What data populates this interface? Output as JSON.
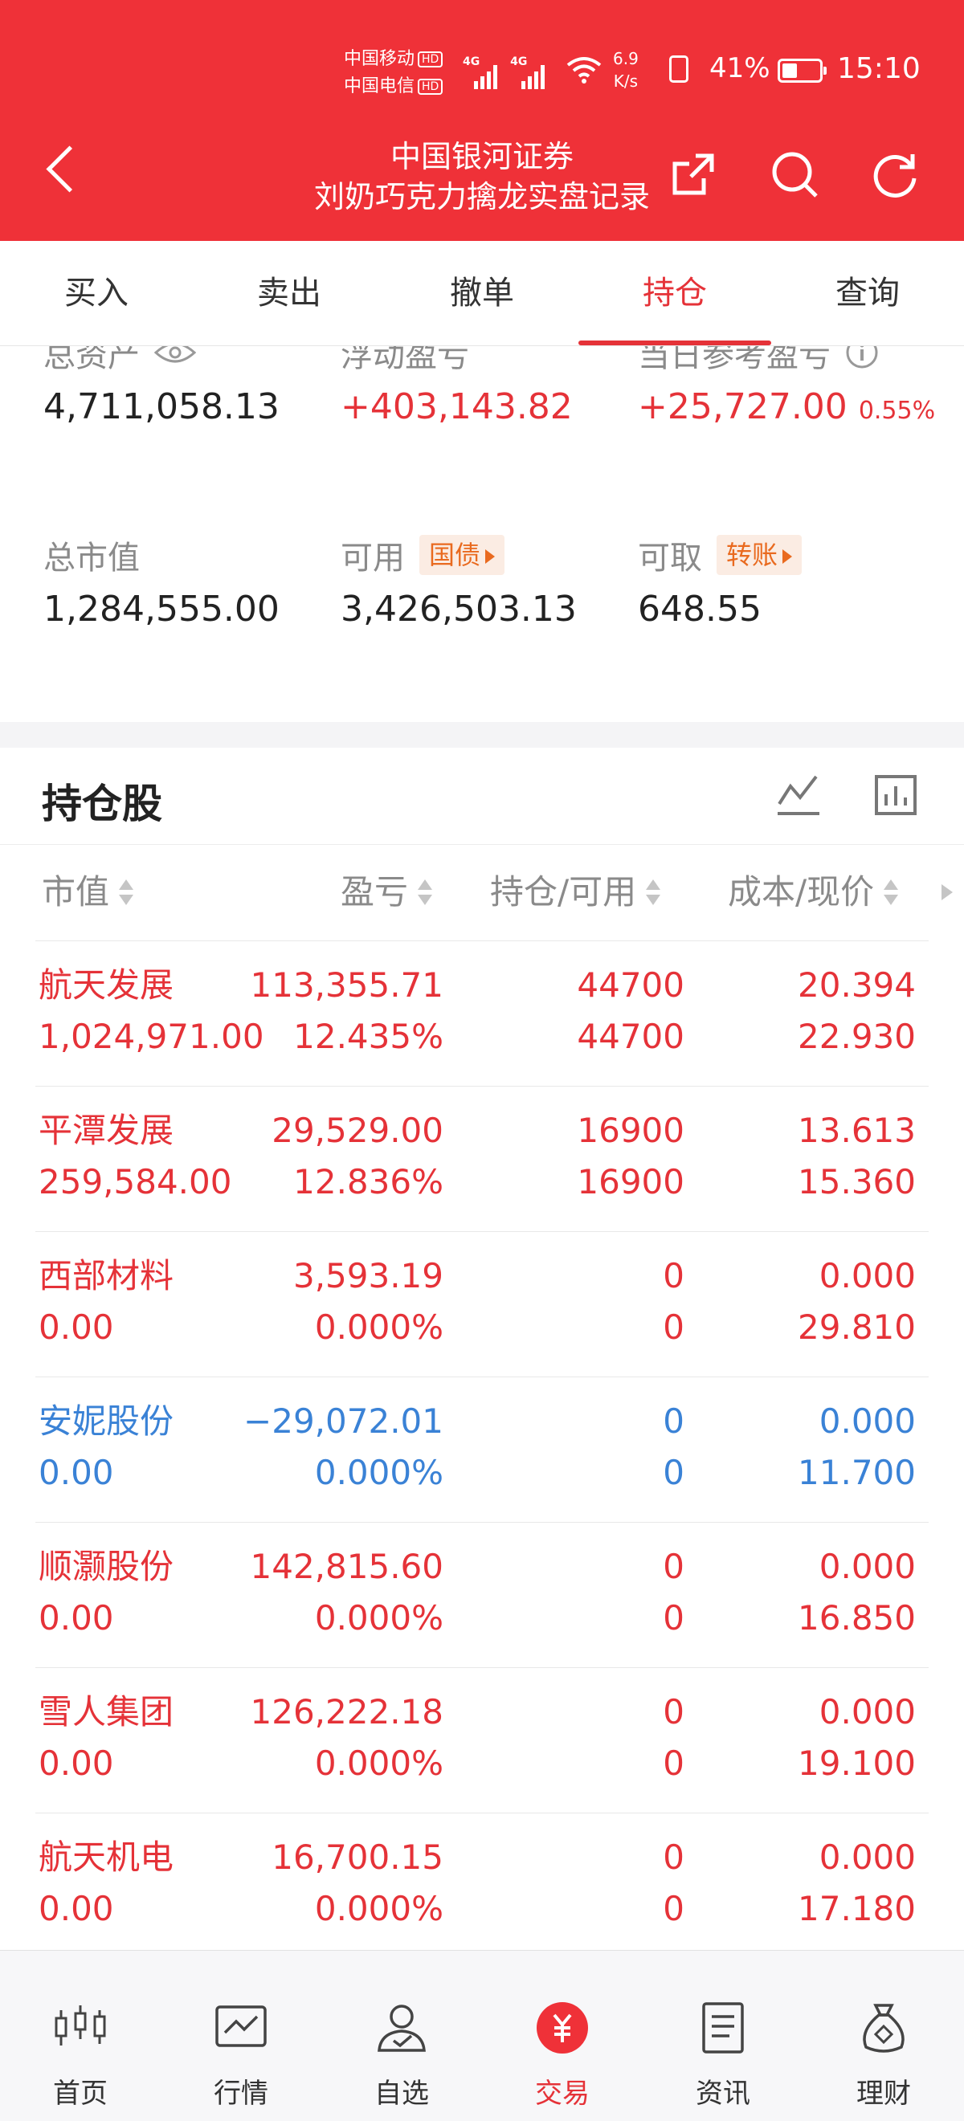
{
  "status_bar": {
    "carrier1": "中国移动",
    "carrier2": "中国电信",
    "hd": "HD",
    "net1": "4G",
    "net2": "4G",
    "speed_value": "6.9",
    "speed_unit": "K/s",
    "battery_pct": "41%",
    "battery_level": 0.41,
    "time": "15:10"
  },
  "header": {
    "title": "中国银河证券",
    "subtitle": "刘奶巧克力擒龙实盘记录",
    "bg_color": "#ef3138"
  },
  "tabs": [
    {
      "label": "买入",
      "active": false
    },
    {
      "label": "卖出",
      "active": false
    },
    {
      "label": "撤单",
      "active": false
    },
    {
      "label": "持仓",
      "active": true
    },
    {
      "label": "查询",
      "active": false
    }
  ],
  "summary": {
    "total_assets_label": "总资产",
    "total_assets": "4,711,058.13",
    "floating_pl_label": "浮动盈亏",
    "floating_pl": "+403,143.82",
    "daily_pl_label": "当日参考盈亏",
    "daily_pl": "+25,727.00",
    "daily_pl_pct": "0.55%",
    "market_value_label": "总市值",
    "market_value": "1,284,555.00",
    "available_label": "可用",
    "available_chip": "国债",
    "available": "3,426,503.13",
    "withdrawable_label": "可取",
    "withdrawable_chip": "转账",
    "withdrawable": "648.55"
  },
  "holdings": {
    "title": "持仓股",
    "columns": {
      "market_value": "市值",
      "profit_loss": "盈亏",
      "position": "持仓/可用",
      "cost_price": "成本/现价"
    },
    "rows": [
      {
        "name": "航天发展",
        "market_value": "1,024,971.00",
        "pl": "113,355.71",
        "pl_pct": "12.435%",
        "hold": "44700",
        "avail": "44700",
        "cost": "20.394",
        "price": "22.930",
        "color": "red"
      },
      {
        "name": "平潭发展",
        "market_value": "259,584.00",
        "pl": "29,529.00",
        "pl_pct": "12.836%",
        "hold": "16900",
        "avail": "16900",
        "cost": "13.613",
        "price": "15.360",
        "color": "red"
      },
      {
        "name": "西部材料",
        "market_value": "0.00",
        "pl": "3,593.19",
        "pl_pct": "0.000%",
        "hold": "0",
        "avail": "0",
        "cost": "0.000",
        "price": "29.810",
        "color": "red"
      },
      {
        "name": "安妮股份",
        "market_value": "0.00",
        "pl": "−29,072.01",
        "pl_pct": "0.000%",
        "hold": "0",
        "avail": "0",
        "cost": "0.000",
        "price": "11.700",
        "color": "blue"
      },
      {
        "name": "顺灏股份",
        "market_value": "0.00",
        "pl": "142,815.60",
        "pl_pct": "0.000%",
        "hold": "0",
        "avail": "0",
        "cost": "0.000",
        "price": "16.850",
        "color": "red"
      },
      {
        "name": "雪人集团",
        "market_value": "0.00",
        "pl": "126,222.18",
        "pl_pct": "0.000%",
        "hold": "0",
        "avail": "0",
        "cost": "0.000",
        "price": "19.100",
        "color": "red"
      },
      {
        "name": "航天机电",
        "market_value": "0.00",
        "pl": "16,700.15",
        "pl_pct": "0.000%",
        "hold": "0",
        "avail": "0",
        "cost": "0.000",
        "price": "17.180",
        "color": "red"
      }
    ]
  },
  "bottom_nav": [
    {
      "label": "首页",
      "icon": "candlestick-icon",
      "active": false
    },
    {
      "label": "行情",
      "icon": "market-chart-icon",
      "active": false
    },
    {
      "label": "自选",
      "icon": "watchlist-user-icon",
      "active": false
    },
    {
      "label": "交易",
      "icon": "yuan-trade-icon",
      "active": true
    },
    {
      "label": "资讯",
      "icon": "news-document-icon",
      "active": false
    },
    {
      "label": "理财",
      "icon": "money-bag-icon",
      "active": false
    }
  ],
  "colors": {
    "up": "#e53238",
    "down": "#3a82d6",
    "accent": "#ef3138",
    "chip": "#e96a1f"
  }
}
